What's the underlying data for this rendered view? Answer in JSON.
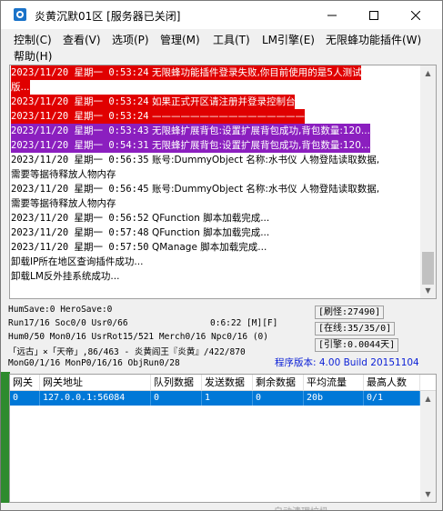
{
  "window": {
    "title": "炎黄沉默01区 [服务器已关闭]",
    "icon": "app-gear-icon"
  },
  "menu": [
    "控制(C)",
    "查看(V)",
    "选项(P)",
    "管理(M)",
    "工具(T)",
    "LM引擎(E)",
    "无限蜂功能插件(W)",
    "帮助(H)"
  ],
  "log": [
    {
      "time": "2023/11/20 星期一 0:53:24",
      "text": "无限蜂功能插件登录失败,你目前使用的是5人测试",
      "style": "red"
    },
    {
      "time": "",
      "text": "版...",
      "style": "red"
    },
    {
      "time": "2023/11/20 星期一 0:53:24",
      "text": "如果正式开区请注册并登录控制台",
      "style": "red"
    },
    {
      "time": "2023/11/20 星期一 0:53:24",
      "text": "————————————————",
      "style": "red"
    },
    {
      "time": "2023/11/20 星期一 0:53:43",
      "text": "无限蜂扩展背包:设置扩展背包成功,背包数量:120...",
      "style": "purple"
    },
    {
      "time": "2023/11/20 星期一 0:54:31",
      "text": "无限蜂扩展背包:设置扩展背包成功,背包数量:120...",
      "style": "purple"
    },
    {
      "time": "2023/11/20 星期一 0:56:35",
      "text": "账号:DummyObject 名称:水书仪 人物登陆读取数据,",
      "style": "plain"
    },
    {
      "time": "",
      "text": "需要等据待释放人物内存",
      "style": "plain"
    },
    {
      "time": "2023/11/20 星期一 0:56:45",
      "text": "账号:DummyObject 名称:水书仪 人物登陆读取数据,",
      "style": "plain"
    },
    {
      "time": "",
      "text": "需要等据待释放人物内存",
      "style": "plain"
    },
    {
      "time": "2023/11/20 星期一 0:56:52",
      "text": "QFunction 脚本加载完成...",
      "style": "plain"
    },
    {
      "time": "2023/11/20 星期一 0:57:48",
      "text": "QFunction 脚本加载完成...",
      "style": "plain"
    },
    {
      "time": "2023/11/20 星期一 0:57:50",
      "text": "QManage 脚本加载完成...",
      "style": "plain"
    },
    {
      "time": "",
      "text": "卸载IP所在地区查询插件成功...",
      "style": "plain"
    },
    {
      "time": "",
      "text": "卸载LM反外挂系统成功...",
      "style": "plain"
    }
  ],
  "status": {
    "line1": "HumSave:0 HeroSave:0",
    "line2a": "Run17/16 Soc0/0 Usr0/66",
    "line2b": "0:6:22 [M][F]",
    "line3": "Hum0/50 Mon0/16 UsrRot15/521 Merch0/16 Npc0/16 (0)",
    "line4": "「远古」×「天帝」,86/463 - 炎黄阎王『炎黄』/422/870",
    "line5": "MonG0/1/16 MonP0/16/16 ObjRun0/28",
    "refresh": "[刷怪:27490]",
    "online": "[在线:35/35/0]",
    "engine": "[引擎:0.0044天]",
    "version": "程序版本: 4.00 Build 20151104"
  },
  "table": {
    "columns": [
      "网关",
      "网关地址",
      "队列数据",
      "发送数据",
      "剩余数据",
      "平均流量",
      "最高人数"
    ],
    "rows": [
      [
        "0",
        "127.0.0.1:56084",
        "0",
        "1",
        "0",
        "20b",
        "0/1"
      ]
    ]
  },
  "footer": {
    "partial_text": "自动清理垃圾"
  },
  "colors": {
    "red_highlight": "#e00000",
    "purple_highlight": "#8b1fbf",
    "selection": "#0078d7",
    "version_text": "#0a1fd6"
  }
}
